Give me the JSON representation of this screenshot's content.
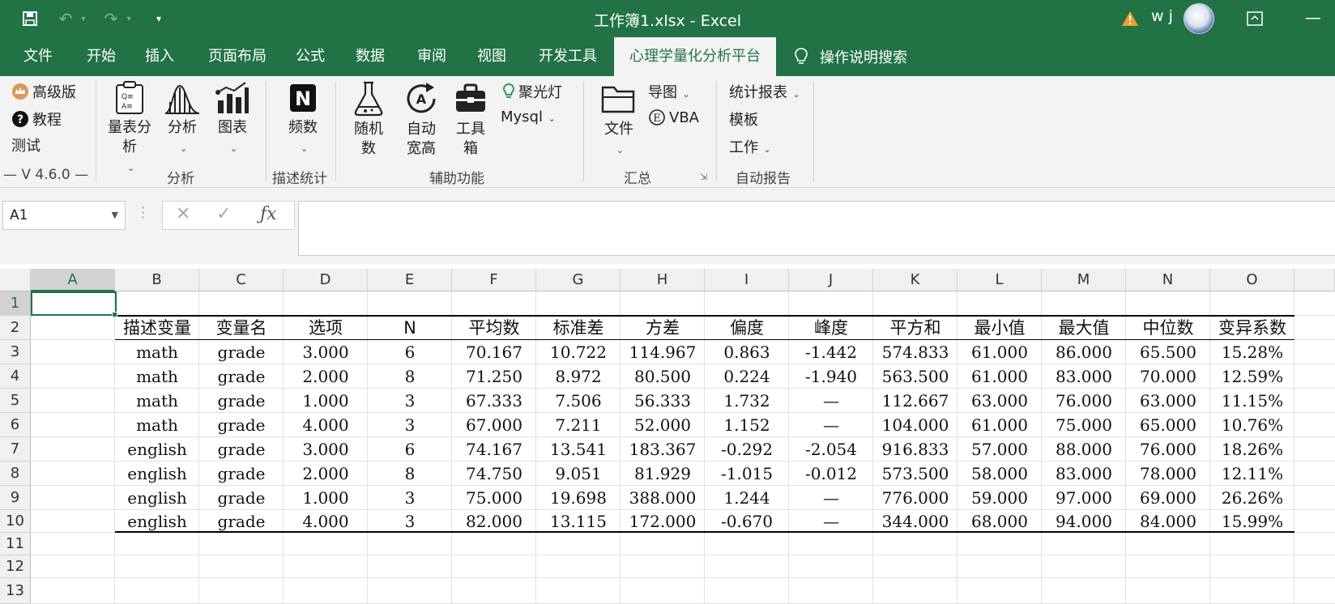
{
  "window": {
    "title": "工作簿1.xlsx  -  Excel",
    "user": "w j",
    "colors": {
      "excel_green": "#217346",
      "ribbon_bg": "#f3f3f3"
    }
  },
  "quick_access": {
    "icons": [
      "save-icon",
      "undo-icon",
      "redo-icon",
      "customize-icon"
    ]
  },
  "tabs": [
    "文件",
    "开始",
    "插入",
    "页面布局",
    "公式",
    "数据",
    "审阅",
    "视图",
    "开发工具",
    "心理学量化分析平台"
  ],
  "active_tab": "心理学量化分析平台",
  "tell_me": "操作说明搜索",
  "ribbon": {
    "left": {
      "premium": "高级版",
      "tutorial": "教程",
      "test": "测试",
      "version": "—  V 4.6.0  —"
    },
    "analysis": {
      "scale": "量表分析",
      "analyze": "分析",
      "chart": "图表",
      "group": "分析"
    },
    "describe": {
      "freq": "频数",
      "group": "描述统计"
    },
    "aux": {
      "random": "随机数",
      "autofit": "自动宽高",
      "toolbox": "工具箱",
      "spotlight": "聚光灯",
      "mysql": "Mysql",
      "group": "辅助功能"
    },
    "summary": {
      "file": "文件",
      "guide": "导图",
      "vba": "VBA",
      "group": "汇总"
    },
    "report": {
      "stats": "统计报表",
      "template": "模板",
      "work": "工作",
      "group": "自动报告"
    }
  },
  "formula_bar": {
    "name_box": "A1",
    "formula": ""
  },
  "columns": [
    "A",
    "B",
    "C",
    "D",
    "E",
    "F",
    "G",
    "H",
    "I",
    "J",
    "K",
    "L",
    "M",
    "N",
    "O"
  ],
  "rows": [
    "1",
    "2",
    "3",
    "4",
    "5",
    "6",
    "7",
    "8",
    "9",
    "10",
    "11",
    "12",
    "13"
  ],
  "table": {
    "header": [
      "描述变量",
      "变量名",
      "选项",
      "N",
      "平均数",
      "标准差",
      "方差",
      "偏度",
      "峰度",
      "平方和",
      "最小值",
      "最大值",
      "中位数",
      "变异系数"
    ],
    "rows": [
      [
        "math",
        "grade",
        "3.000",
        "6",
        "70.167",
        "10.722",
        "114.967",
        "0.863",
        "-1.442",
        "574.833",
        "61.000",
        "86.000",
        "65.500",
        "15.28%"
      ],
      [
        "math",
        "grade",
        "2.000",
        "8",
        "71.250",
        "8.972",
        "80.500",
        "0.224",
        "-1.940",
        "563.500",
        "61.000",
        "83.000",
        "70.000",
        "12.59%"
      ],
      [
        "math",
        "grade",
        "1.000",
        "3",
        "67.333",
        "7.506",
        "56.333",
        "1.732",
        "—",
        "112.667",
        "63.000",
        "76.000",
        "63.000",
        "11.15%"
      ],
      [
        "math",
        "grade",
        "4.000",
        "3",
        "67.000",
        "7.211",
        "52.000",
        "1.152",
        "—",
        "104.000",
        "61.000",
        "75.000",
        "65.000",
        "10.76%"
      ],
      [
        "english",
        "grade",
        "3.000",
        "6",
        "74.167",
        "13.541",
        "183.367",
        "-0.292",
        "-2.054",
        "916.833",
        "57.000",
        "88.000",
        "76.000",
        "18.26%"
      ],
      [
        "english",
        "grade",
        "2.000",
        "8",
        "74.750",
        "9.051",
        "81.929",
        "-1.015",
        "-0.012",
        "573.500",
        "58.000",
        "83.000",
        "78.000",
        "12.11%"
      ],
      [
        "english",
        "grade",
        "1.000",
        "3",
        "75.000",
        "19.698",
        "388.000",
        "1.244",
        "—",
        "776.000",
        "59.000",
        "97.000",
        "69.000",
        "26.26%"
      ],
      [
        "english",
        "grade",
        "4.000",
        "3",
        "82.000",
        "13.115",
        "172.000",
        "-0.670",
        "—",
        "344.000",
        "68.000",
        "94.000",
        "84.000",
        "15.99%"
      ]
    ]
  }
}
